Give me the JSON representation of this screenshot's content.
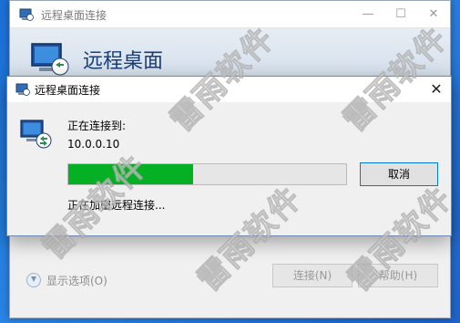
{
  "main_window": {
    "title": "远程桌面连接",
    "header_title": "远程桌面",
    "controls": {
      "minimize": "—",
      "maximize": "☐",
      "close": "✕"
    },
    "show_options": "显示选项(O)",
    "connect_button": "连接(N)",
    "help_button": "帮助(H)"
  },
  "dialog": {
    "title": "远程桌面连接",
    "close": "✕",
    "connecting_label": "正在连接到:",
    "address": "10.0.0.10",
    "progress_percent": 45,
    "cancel_button": "取消",
    "status": "正在加密远程连接..."
  },
  "watermark": "雷雨软件",
  "colors": {
    "progress_fill": "#06b025",
    "accent": "#0078d7",
    "desktop": "#2a86e6"
  }
}
